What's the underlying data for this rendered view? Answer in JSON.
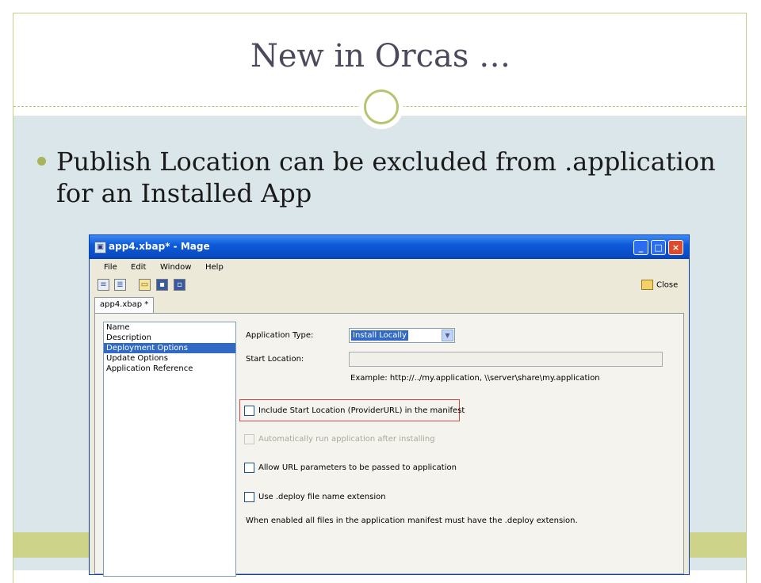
{
  "slide": {
    "title": "New in Orcas …",
    "bullet": "Publish Location can be excluded from .application for an Installed App"
  },
  "window": {
    "title": "app4.xbap* - Mage",
    "title_icon": "mage-app-icon",
    "controls": {
      "minimize": "_",
      "maximize": "□",
      "close": "×"
    },
    "menu": [
      "File",
      "Edit",
      "Window",
      "Help"
    ],
    "toolbar": {
      "icons": [
        "new-application-manifest-icon",
        "new-deployment-manifest-icon",
        "open-icon",
        "save-icon",
        "save-all-icon"
      ],
      "close_label": "Close"
    },
    "tab_label": "app4.xbap *",
    "nav_items": [
      {
        "label": "Name",
        "selected": false
      },
      {
        "label": "Description",
        "selected": false
      },
      {
        "label": "Deployment Options",
        "selected": true
      },
      {
        "label": "Update Options",
        "selected": false
      },
      {
        "label": "Application Reference",
        "selected": false
      }
    ],
    "form": {
      "application_type_label": "Application Type:",
      "application_type_value": "Install Locally",
      "start_location_label": "Start Location:",
      "start_location_value": "",
      "example_text": "Example: http://../my.application, \\\\server\\share\\my.application",
      "include_start_location": {
        "label": "Include Start Location (ProviderURL) in the manifest",
        "checked": false,
        "enabled": true
      },
      "auto_run": {
        "label": "Automatically run application after installing",
        "checked": false,
        "enabled": false
      },
      "allow_url_params": {
        "label": "Allow URL parameters to be passed to application",
        "checked": false,
        "enabled": true
      },
      "use_deploy_ext": {
        "label": "Use .deploy file name extension",
        "checked": false,
        "enabled": true
      },
      "deploy_note": "When enabled all files in the application manifest must have the .deploy extension."
    }
  },
  "colors": {
    "title_text": "#4a4a5c",
    "band": "#dbe6ea",
    "accent_green": "#b9c36e",
    "selection": "#316ac5",
    "highlight_border": "#d94848"
  }
}
